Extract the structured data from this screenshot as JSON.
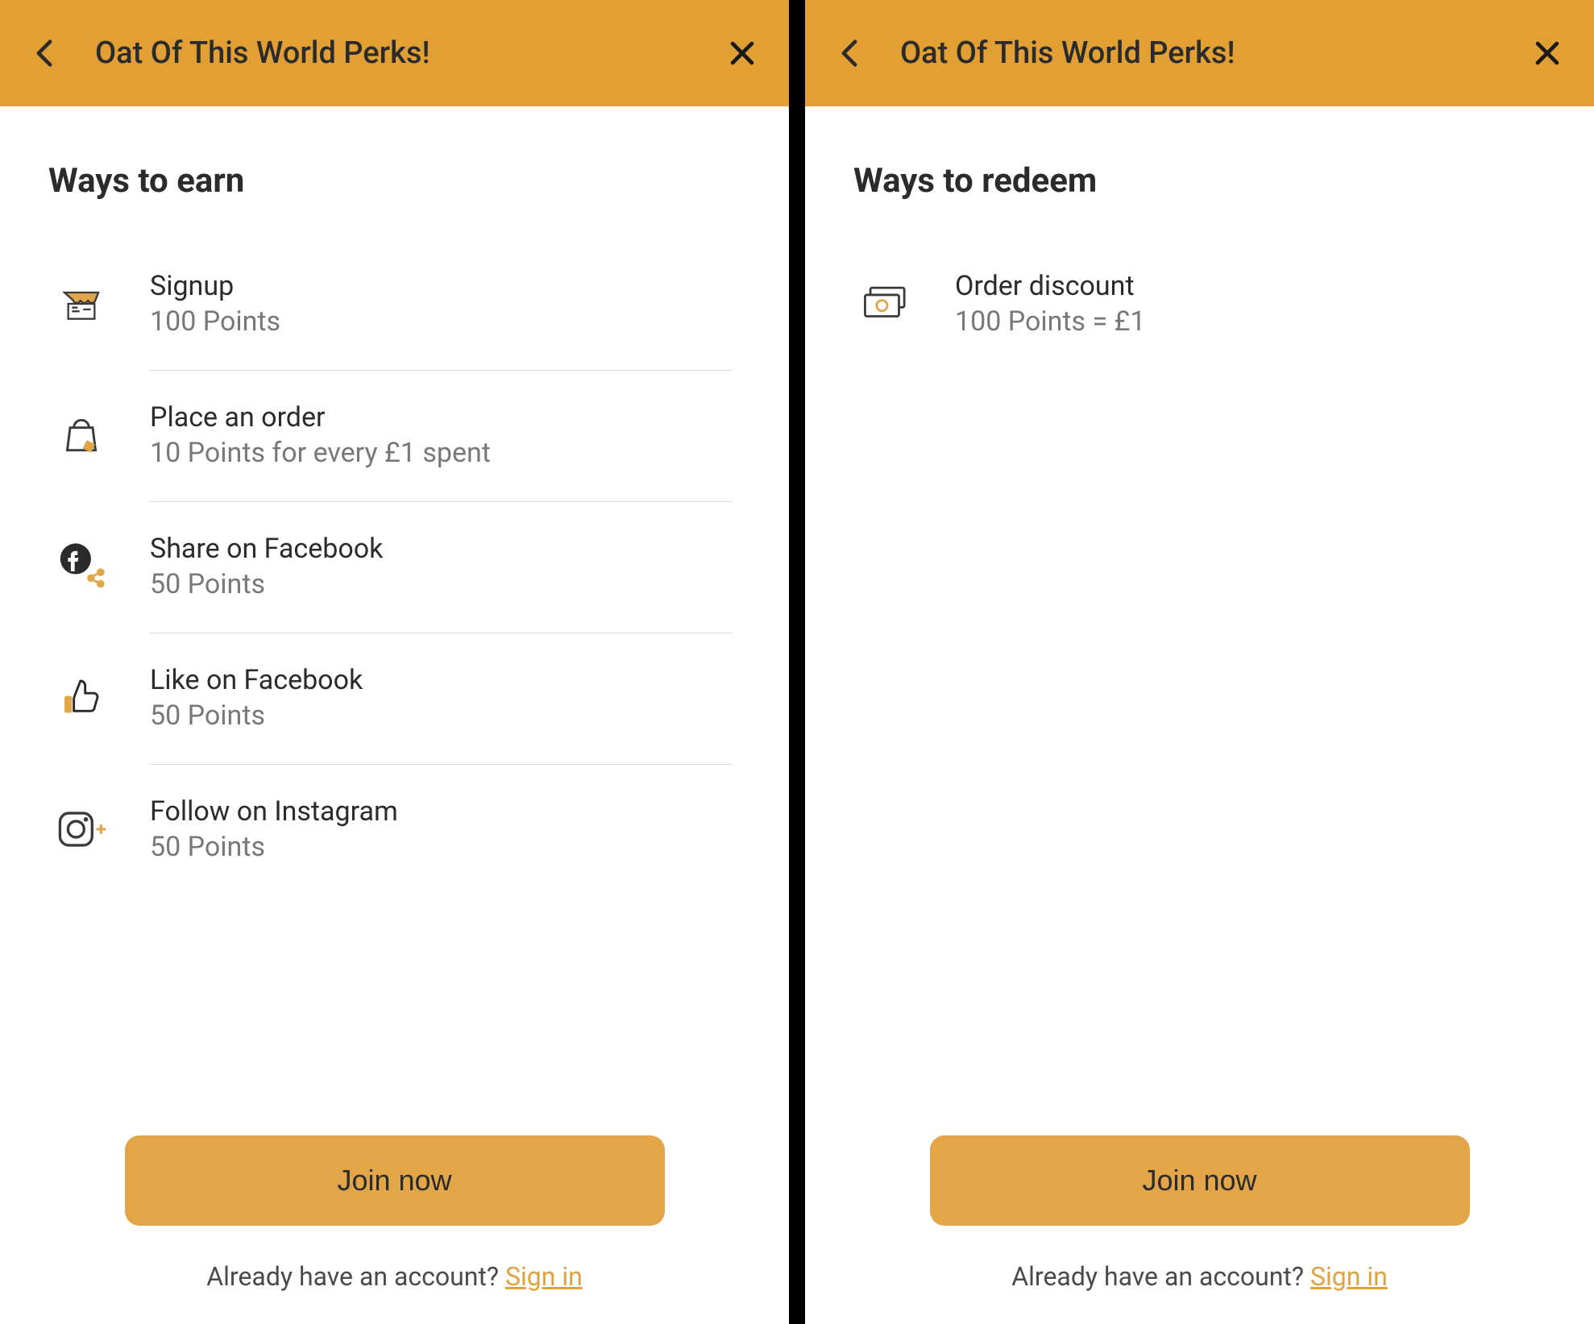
{
  "left": {
    "header_title": "Oat Of This World Perks!",
    "section_title": "Ways to earn",
    "items": [
      {
        "icon": "store-icon",
        "title": "Signup",
        "subtitle": "100 Points"
      },
      {
        "icon": "shopping-bag-icon",
        "title": "Place an order",
        "subtitle": "10 Points for every £1 spent"
      },
      {
        "icon": "facebook-share-icon",
        "title": "Share on Facebook",
        "subtitle": "50 Points"
      },
      {
        "icon": "thumbs-up-icon",
        "title": "Like on Facebook",
        "subtitle": "50 Points"
      },
      {
        "icon": "instagram-icon",
        "title": "Follow on Instagram",
        "subtitle": "50 Points"
      }
    ],
    "join_label": "Join now",
    "account_text": "Already have an account? ",
    "signin_label": "Sign in"
  },
  "right": {
    "header_title": "Oat Of This World Perks!",
    "section_title": "Ways to redeem",
    "items": [
      {
        "icon": "cash-icon",
        "title": "Order discount",
        "subtitle": "100 Points = £1"
      }
    ],
    "join_label": "Join now",
    "account_text": "Already have an account? ",
    "signin_label": "Sign in"
  }
}
